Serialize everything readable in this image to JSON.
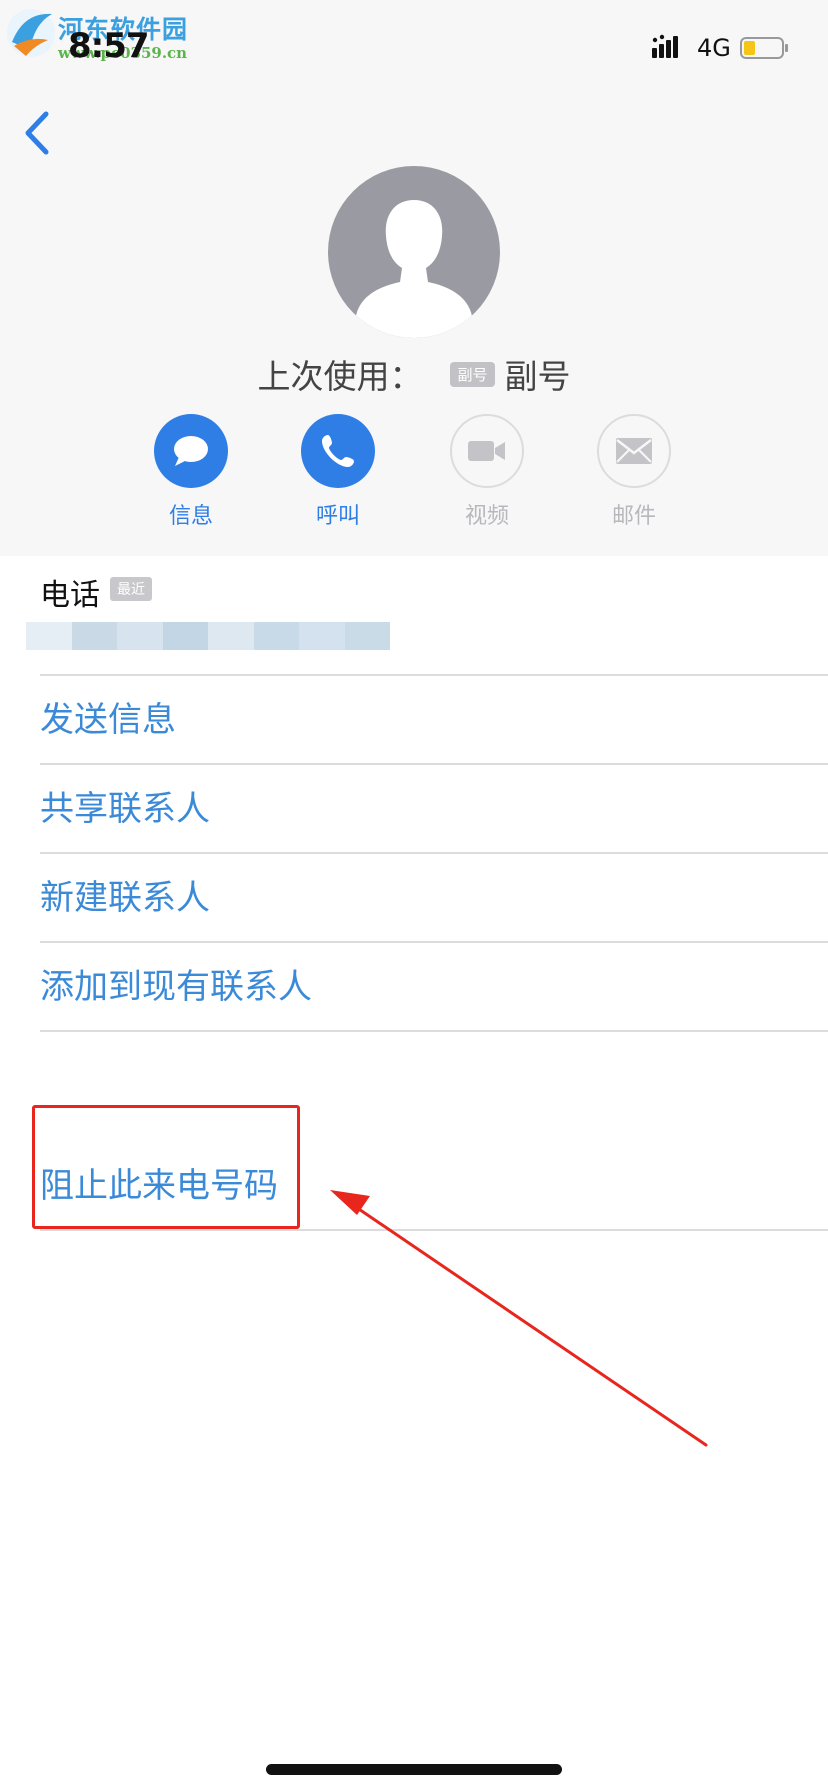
{
  "watermark": {
    "title": "河东软件园",
    "url": "www.pc0359.cn"
  },
  "status_bar": {
    "time": "8:57",
    "network": "4G"
  },
  "contact": {
    "last_used_label": "上次使用：",
    "last_used_badge": "副号",
    "last_used_value": "副号"
  },
  "actions": [
    {
      "label": "信息",
      "icon": "message-icon",
      "enabled": true
    },
    {
      "label": "呼叫",
      "icon": "phone-icon",
      "enabled": true
    },
    {
      "label": "视频",
      "icon": "video-icon",
      "enabled": false
    },
    {
      "label": "邮件",
      "icon": "mail-icon",
      "enabled": false
    }
  ],
  "phone": {
    "label": "电话",
    "badge": "最近"
  },
  "menu": [
    {
      "label": "发送信息"
    },
    {
      "label": "共享联系人"
    },
    {
      "label": "新建联系人"
    },
    {
      "label": "添加到现有联系人"
    }
  ],
  "block_item": {
    "label": "阻止此来电号码"
  },
  "colors": {
    "accent": "#2f7ee6",
    "link": "#3b8ad8",
    "highlight": "#e8261e"
  }
}
